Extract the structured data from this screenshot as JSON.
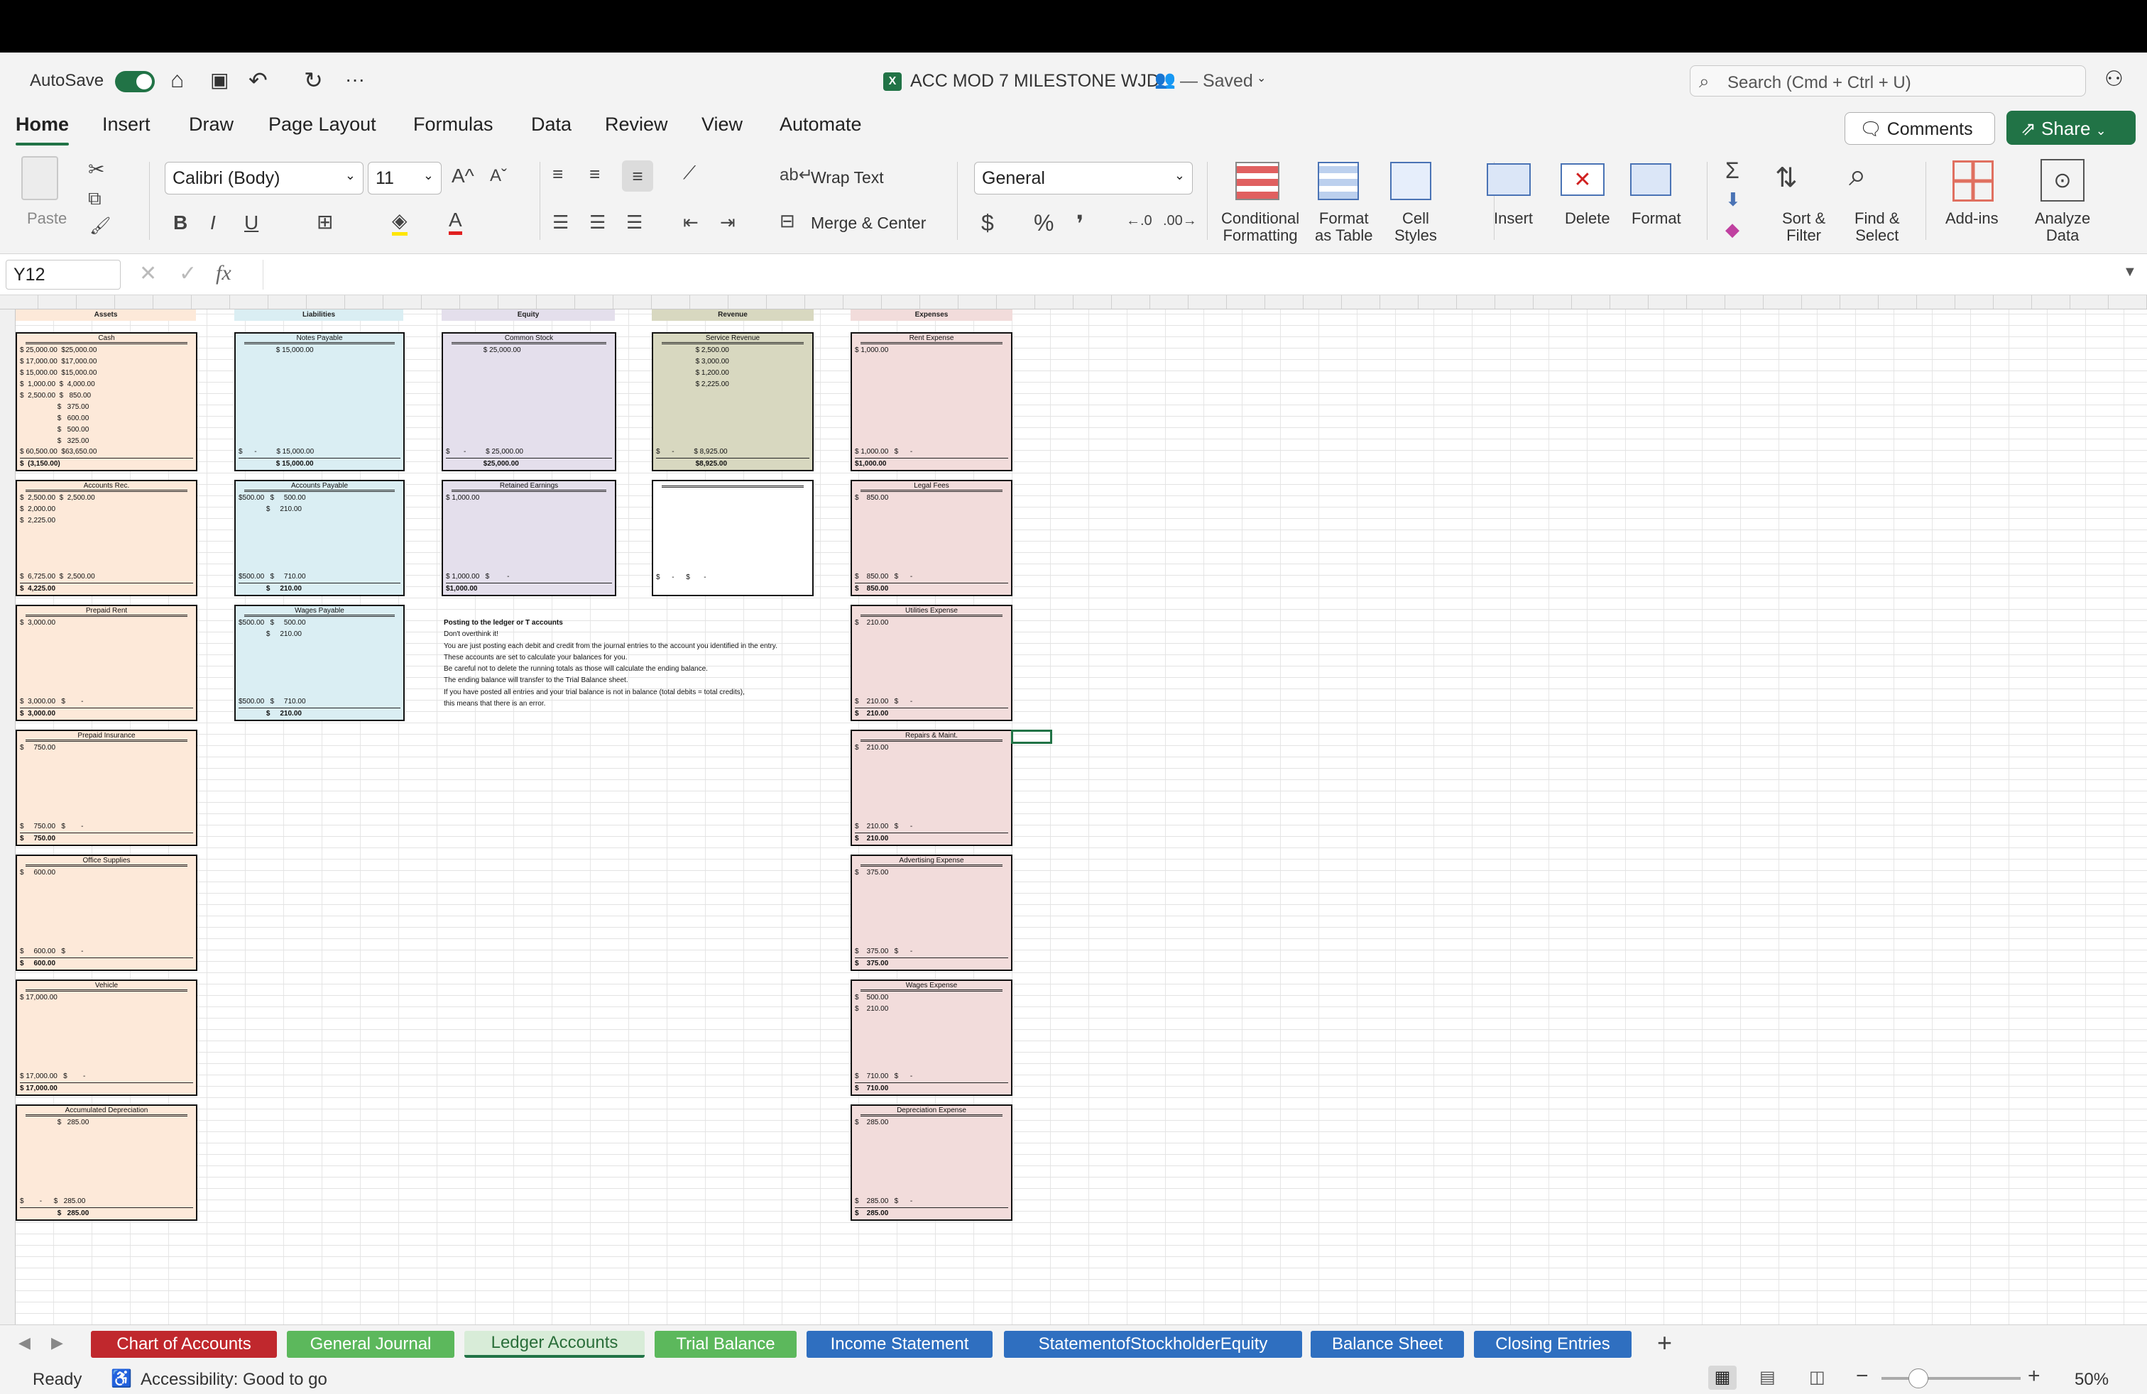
{
  "title_bar": {
    "autosave_label": "AutoSave",
    "file_name": "ACC MOD 7 MILESTONE WJD",
    "save_status": "— Saved",
    "search_placeholder": "Search (Cmd + Ctrl + U)"
  },
  "ribbon_tabs": [
    "Home",
    "Insert",
    "Draw",
    "Page Layout",
    "Formulas",
    "Data",
    "Review",
    "View",
    "Automate"
  ],
  "actions": {
    "comments": "Comments",
    "share": "Share"
  },
  "ribbon": {
    "paste": "Paste",
    "font": "Calibri (Body)",
    "font_size": "11",
    "wrap_text": "Wrap Text",
    "merge_center": "Merge & Center",
    "number_format": "General",
    "conditional_formatting": "Conditional\nFormatting",
    "format_as_table": "Format\nas Table",
    "cell_styles": "Cell\nStyles",
    "insert": "Insert",
    "delete": "Delete",
    "format": "Format",
    "sort_filter": "Sort &\nFilter",
    "find_select": "Find &\nSelect",
    "add_ins": "Add-ins",
    "analyze_data": "Analyze\nData"
  },
  "formula_bar": {
    "name_box": "Y12",
    "fx": "fx",
    "content": ""
  },
  "section_headers": {
    "assets": "Assets",
    "liabilities": "Liabilities",
    "equity": "Equity",
    "revenue": "Revenue",
    "expenses": "Expenses"
  },
  "accounts": {
    "cash": {
      "name": "Cash",
      "lines": "$ 25,000.00  $25,000.00\n$ 17,000.00  $17,000.00\n$ 15,000.00  $15,000.00\n$  1,000.00  $  4,000.00\n$  2,500.00  $   850.00\n                   $   375.00\n                   $   600.00\n                   $   500.00\n                   $   325.00",
      "total": "$ 60,500.00  $63,650.00",
      "balance": "$  (3,150.00)"
    },
    "accounts_rec": {
      "name": "Accounts Rec.",
      "lines": "$  2,500.00  $  2,500.00\n$  2,000.00\n$  2,225.00",
      "total": "$  6,725.00  $  2,500.00",
      "balance": "$  4,225.00"
    },
    "prepaid_rent": {
      "name": "Prepaid Rent",
      "lines": "$  3,000.00",
      "total": "$  3,000.00   $        -",
      "balance": "$  3,000.00"
    },
    "prepaid_insurance": {
      "name": "Prepaid Insurance",
      "lines": "$     750.00",
      "total": "$     750.00   $        -",
      "balance": "$     750.00"
    },
    "office_supplies": {
      "name": "Office Supplies",
      "lines": "$     600.00",
      "total": "$     600.00   $        -",
      "balance": "$     600.00"
    },
    "vehicle": {
      "name": "Vehicle",
      "lines": "$ 17,000.00",
      "total": "$ 17,000.00   $        -",
      "balance": "$ 17,000.00"
    },
    "accumulated_depreciation": {
      "name": "Accumulated Depreciation",
      "lines": "                   $   285.00",
      "total": "$        -      $   285.00",
      "balance": "                   $   285.00"
    },
    "notes_payable": {
      "name": "Notes Payable",
      "lines": "                   $ 15,000.00",
      "total": "$      -          $ 15,000.00",
      "balance": "                   $ 15,000.00"
    },
    "accounts_payable": {
      "name": "Accounts Payable",
      "lines": "$500.00   $     500.00\n              $     210.00",
      "total": "$500.00   $     710.00",
      "balance": "              $     210.00"
    },
    "wages_payable": {
      "name": "Wages Payable",
      "lines": "$500.00   $     500.00\n              $     210.00",
      "total": "$500.00   $     710.00",
      "balance": "              $     210.00"
    },
    "common_stock": {
      "name": "Common Stock",
      "lines": "                   $ 25,000.00",
      "total": "$       -          $ 25,000.00",
      "balance": "                   $25,000.00"
    },
    "retained_earnings": {
      "name": "Retained Earnings",
      "lines": "$ 1,000.00",
      "total": "$ 1,000.00   $         -",
      "balance": "$1,000.00"
    },
    "service_revenue": {
      "name": "Service Revenue",
      "lines": "                    $ 2,500.00\n                    $ 3,000.00\n                    $ 1,200.00\n                    $ 2,225.00",
      "total": "$      -          $ 8,925.00",
      "balance": "                    $8,925.00"
    },
    "blank_revenue": {
      "name": "",
      "lines": "",
      "total": "$      -      $       -",
      "balance": ""
    },
    "rent_expense": {
      "name": "Rent Expense",
      "lines": "$ 1,000.00",
      "total": "$ 1,000.00   $      -",
      "balance": "$1,000.00"
    },
    "legal_fees": {
      "name": "Legal Fees",
      "lines": "$    850.00",
      "total": "$    850.00   $      -",
      "balance": "$    850.00"
    },
    "utilities_expense": {
      "name": "Utilities Expense",
      "lines": "$    210.00",
      "total": "$    210.00   $      -",
      "balance": "$    210.00"
    },
    "repairs_maint": {
      "name": "Repairs & Maint.",
      "lines": "$    210.00",
      "total": "$    210.00   $      -",
      "balance": "$    210.00"
    },
    "advertising_expense": {
      "name": "Advertising Expense",
      "lines": "$    375.00",
      "total": "$    375.00   $      -",
      "balance": "$    375.00"
    },
    "wages_expense": {
      "name": "Wages Expense",
      "lines": "$    500.00\n$    210.00",
      "total": "$    710.00   $      -",
      "balance": "$    710.00"
    },
    "depreciation_expense": {
      "name": "Depreciation Expense",
      "lines": "$    285.00",
      "total": "$    285.00   $      -",
      "balance": "$    285.00"
    }
  },
  "instructions": {
    "heading": "Posting to the ledger or T accounts",
    "lines": [
      "Don't overthink it!",
      "You are just posting each debit and credit from the journal entries to the account you identified in the entry.",
      "These accounts are set to calculate your balances for you.",
      "Be careful not to delete the running totals as those will calculate the ending balance.",
      "The ending balance will transfer to the Trial Balance sheet.",
      "If you have posted all entries and your trial balance is not in balance (total debits = total credits),",
      "this means that there is an error."
    ]
  },
  "sheet_tabs": [
    {
      "label": "Chart of Accounts",
      "color": "#c0282d"
    },
    {
      "label": "General Journal",
      "color": "#5cb85c"
    },
    {
      "label": "Ledger Accounts",
      "color": "#d8ecd8"
    },
    {
      "label": "Trial Balance",
      "color": "#5cb85c"
    },
    {
      "label": "Income Statement",
      "color": "#2f6fc0"
    },
    {
      "label": "StatementofStockholderEquity",
      "color": "#2f6fc0"
    },
    {
      "label": "Balance Sheet",
      "color": "#2f6fc0"
    },
    {
      "label": "Closing Entries",
      "color": "#2f6fc0"
    }
  ],
  "status": {
    "ready": "Ready",
    "accessibility": "Accessibility: Good to go",
    "zoom": "50%"
  },
  "colors": {
    "accent": "#217346",
    "assets_fill": "#fde9d9",
    "liabilities_fill": "#daeef3",
    "equity_fill": "#e4dfec",
    "revenue_fill": "#d8d8c0",
    "expenses_fill": "#f2dcdb"
  }
}
